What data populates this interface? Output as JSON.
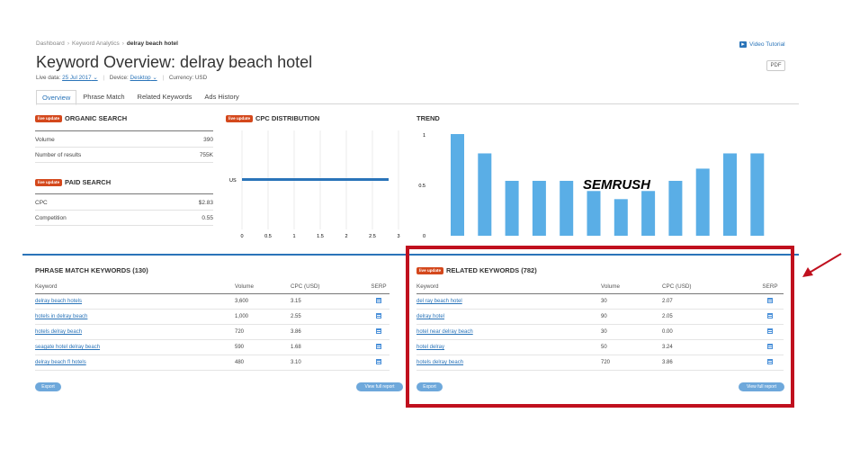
{
  "breadcrumb": {
    "items": [
      "Dashboard",
      "Keyword Analytics"
    ],
    "current": "delray beach hotel"
  },
  "video_tutorial": "Video Tutorial",
  "page_title": "Keyword Overview: delray beach hotel",
  "pdf_button": "PDF",
  "meta": {
    "live_label": "Live data:",
    "live_value": "25 Jul 2017",
    "device_label": "Device:",
    "device_value": "Desktop",
    "currency": "Currency: USD"
  },
  "tabs": [
    "Overview",
    "Phrase Match",
    "Related Keywords",
    "Ads History"
  ],
  "badge_text": "live update",
  "organic": {
    "title": "ORGANIC SEARCH",
    "rows": [
      {
        "label": "Volume",
        "value": "390"
      },
      {
        "label": "Number of results",
        "value": "755K"
      }
    ]
  },
  "paid": {
    "title": "PAID SEARCH",
    "rows": [
      {
        "label": "CPC",
        "value": "$2.83"
      },
      {
        "label": "Competition",
        "value": "0.55"
      }
    ]
  },
  "cpc_dist": {
    "title": "CPC DISTRIBUTION",
    "y_label": "US",
    "x_ticks": [
      "0",
      "0.5",
      "1",
      "1.5",
      "2",
      "2.5",
      "3"
    ]
  },
  "trend": {
    "title": "TREND",
    "y_ticks": [
      "1",
      "0.5",
      "0"
    ],
    "watermark": "SEMRUSH",
    "values": [
      1.0,
      0.81,
      0.54,
      0.54,
      0.54,
      0.44,
      0.36,
      0.44,
      0.54,
      0.66,
      0.81,
      0.81
    ]
  },
  "phrase_match": {
    "title": "PHRASE MATCH KEYWORDS (130)",
    "headers": [
      "Keyword",
      "Volume",
      "CPC (USD)",
      "SERP"
    ],
    "rows": [
      {
        "keyword": "delray beach hotels",
        "volume": "3,600",
        "cpc": "3.15"
      },
      {
        "keyword": "hotels in delray beach",
        "volume": "1,000",
        "cpc": "2.55"
      },
      {
        "keyword": "hotels delray beach",
        "volume": "720",
        "cpc": "3.86"
      },
      {
        "keyword": "seagate hotel delray beach",
        "volume": "590",
        "cpc": "1.68"
      },
      {
        "keyword": "delray beach fl hotels",
        "volume": "480",
        "cpc": "3.10"
      }
    ],
    "export": "Export",
    "view_full": "View full report"
  },
  "related": {
    "title": "RELATED KEYWORDS (782)",
    "headers": [
      "Keyword",
      "Volume",
      "CPC (USD)",
      "SERP"
    ],
    "rows": [
      {
        "keyword": "del ray beach hotel",
        "volume": "30",
        "cpc": "2.07"
      },
      {
        "keyword": "delray hotel",
        "volume": "90",
        "cpc": "2.05"
      },
      {
        "keyword": "hotel near delray beach",
        "volume": "30",
        "cpc": "0.00"
      },
      {
        "keyword": "hotel delray",
        "volume": "50",
        "cpc": "3.24"
      },
      {
        "keyword": "hotels delray beach",
        "volume": "720",
        "cpc": "3.86"
      }
    ],
    "export": "Export",
    "view_full": "View full report"
  },
  "colors": {
    "accent": "#2a74b9",
    "bar": "#5aaee6",
    "badge": "#d4481c",
    "highlight": "#c0101e"
  }
}
